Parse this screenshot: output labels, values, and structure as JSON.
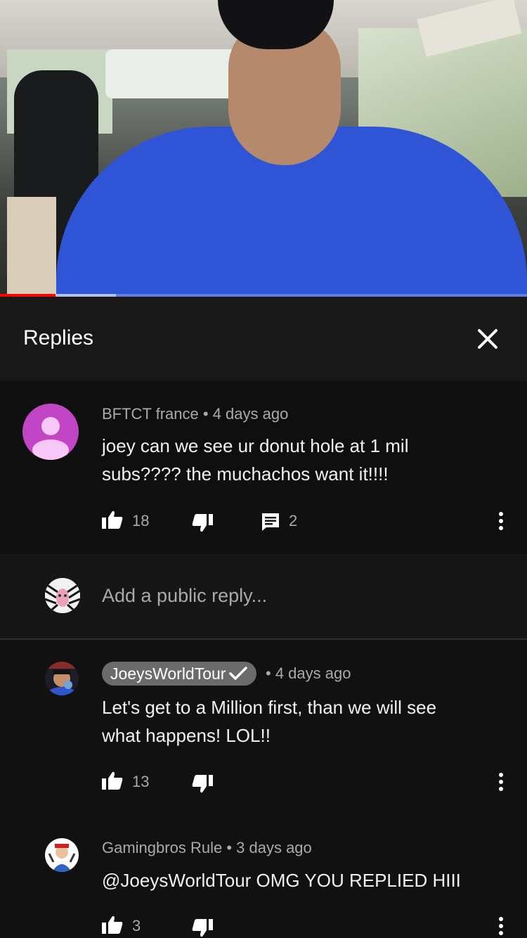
{
  "video": {
    "progress_played": 0.105,
    "progress_buffered": 0.22
  },
  "header": {
    "title": "Replies"
  },
  "parent_comment": {
    "author": "BFTCT france",
    "separator": "•",
    "time": "4 days ago",
    "text_line1": "joey can we see ur donut hole at 1 mil",
    "text_line2": "subs???? the muchachos want it!!!!",
    "likes": "18",
    "replies": "2"
  },
  "reply_box": {
    "placeholder": "Add a public reply..."
  },
  "replies": [
    {
      "author": "JoeysWorldTour",
      "verified": true,
      "separator": "•",
      "time": "4 days ago",
      "text_line1": "Let's get to a Million first, than we will see",
      "text_line2": "what happens!  LOL!!",
      "likes": "13"
    },
    {
      "author": "Gamingbros Rule",
      "separator": "•",
      "time": "3 days ago",
      "text_line1": "@JoeysWorldTour OMG YOU REPLIED HIII",
      "likes": "3"
    }
  ],
  "colors": {
    "accent": "#ff0000",
    "avatar_purple": "#c146c6",
    "chip_bg": "#6b6b6b"
  }
}
